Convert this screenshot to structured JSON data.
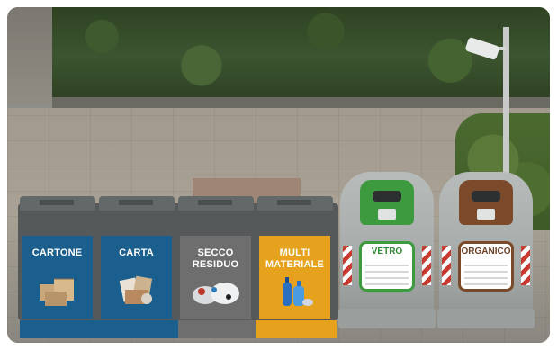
{
  "colors": {
    "cartone": "#1b5f8e",
    "carta": "#1b5f8e",
    "secco": "#6e6e6e",
    "multi": "#e6a21d",
    "vetro_cap": "#3e9a3f",
    "vetro_text": "#2e8a34",
    "organico_cap": "#7a4a2a",
    "organico_text": "#6b3f22"
  },
  "bins": [
    {
      "id": "cartone",
      "label": "CARTONE",
      "icon": "cardboard-boxes-icon"
    },
    {
      "id": "carta",
      "label": "CARTA",
      "icon": "paper-icon"
    },
    {
      "id": "secco",
      "label": "SECCO RESIDUO",
      "icon": "residual-waste-icon"
    },
    {
      "id": "multi",
      "label": "MULTI MATERIALE",
      "icon": "plastic-bottles-icon"
    }
  ],
  "bells": [
    {
      "id": "vetro",
      "label": "VETRO",
      "icon": "glass-bottle-icon"
    },
    {
      "id": "organico",
      "label": "ORGANICO",
      "icon": "organic-waste-icon"
    }
  ]
}
